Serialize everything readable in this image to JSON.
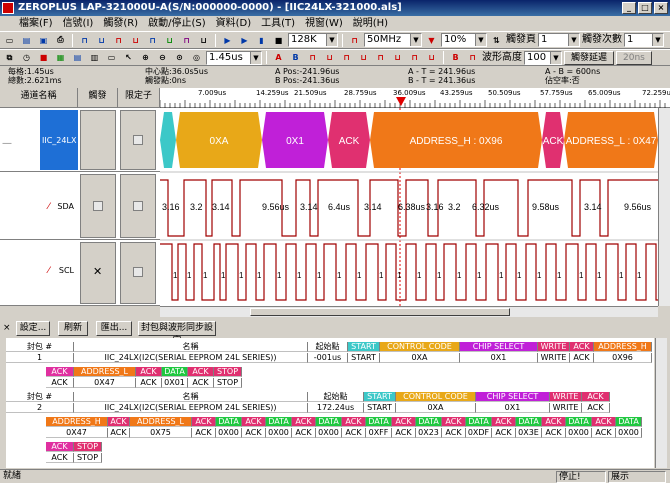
{
  "window": {
    "title": "ZEROPLUS LAP-321000U-A(S/N:000000-0000) - [IIC24LX-321000.als]"
  },
  "menu": [
    "檔案(F)",
    "信號(I)",
    "觸發(R)",
    "啟動/停止(S)",
    "資料(D)",
    "工具(T)",
    "視窗(W)",
    "說明(H)"
  ],
  "toolbar1": {
    "memory": "128K",
    "freq": "50MHz",
    "trigger_pos": "10%",
    "trigger_page_label": "觸發頁",
    "trigger_page": "1",
    "trigger_count_label": "觸發次數",
    "trigger_count": "1"
  },
  "toolbar2": {
    "time_div": "1.45us",
    "wave_height_label": "波形高度",
    "wave_height": "100",
    "trigger_delay": "觸發延遲",
    "delay_value": "20ns"
  },
  "info": {
    "per_div": "每格:1.45us",
    "total": "總數:2.621ms",
    "center": "中心點:36.0s5us",
    "trigger_point": "觸發點:0ns",
    "a_pos": "A Pos:-241.96us",
    "b_pos": "B Pos:-241.36us",
    "a_t": "A - T = 241.96us",
    "b_t": "B - T = 241.36us",
    "a_b": "A - B = 600ns",
    "duty": "佔空率:否"
  },
  "headers": {
    "channel_name": "通道名稱",
    "trigger": "觸發",
    "fixed": "限定子"
  },
  "ruler_ticks": [
    "7.009us",
    "14.259us",
    "21.509us",
    "28.759us",
    "36.009us",
    "43.259us",
    "50.509us",
    "57.759us",
    "65.009us",
    "72.259us"
  ],
  "channels": [
    {
      "name": "IIC_24LX",
      "color": "#1e6fd6"
    },
    {
      "name": "SDA"
    },
    {
      "name": "SCL"
    }
  ],
  "bus_segments": [
    {
      "label": "",
      "color": "#3cc8c8"
    },
    {
      "label": "0XA",
      "color": "#e8a818"
    },
    {
      "label": "0X1",
      "color": "#c020d8"
    },
    {
      "label": "ACK",
      "color": "#e03070"
    },
    {
      "label": "ADDRESS_H : 0X96",
      "color": "#f07818"
    },
    {
      "label": "ACK",
      "color": "#e03070"
    },
    {
      "label": "ADDRESS_L : 0X47",
      "color": "#f07818"
    }
  ],
  "sda_labels": [
    "3.16",
    "3.2",
    "3.14",
    "9.56us",
    "3.14",
    "6.4us",
    "3.14",
    "6.38us",
    "3.16",
    "3.2",
    "6.32us",
    "9.58us",
    "3.14",
    "9.56us"
  ],
  "panel_buttons": [
    "設定...",
    "刷新",
    "匯出...",
    "封包與波形同步設定"
  ],
  "decode": {
    "h_packet": "封包 #",
    "h_name": "名稱",
    "h_start": "起始點",
    "p1_num": "1",
    "p1_name": "IIC_24LX(I2C(SERIAL EEPROM 24L SERIES))",
    "p1_start": "-001us",
    "p2_num": "2",
    "p2_name": "IIC_24LX(I2C(SERIAL EEPROM 24L SERIES))",
    "p2_start": "172.24us",
    "f_start": "START",
    "f_control": "CONTROL CODE",
    "f_chip": "CHIP SELECT",
    "f_write": "WRITE",
    "f_ack": "ACK",
    "f_addr_h": "ADDRESS_H",
    "f_addr_l": "ADDRESS_L",
    "f_data": "DATA",
    "f_stop": "STOP",
    "v_0xa": "0XA",
    "v_0x1": "0X1",
    "v_0x96": "0X96",
    "v_0x47": "0X47",
    "v_0x01": "0X01",
    "v_0x75": "0X75",
    "v_0x00": "0X00",
    "v_0xff": "0XFF",
    "v_0x23": "0X23",
    "v_0xdf": "0XDF",
    "v_0x3e": "0X3E"
  },
  "status": {
    "ready": "就緒",
    "stop": "停止!",
    "display": "展示"
  }
}
